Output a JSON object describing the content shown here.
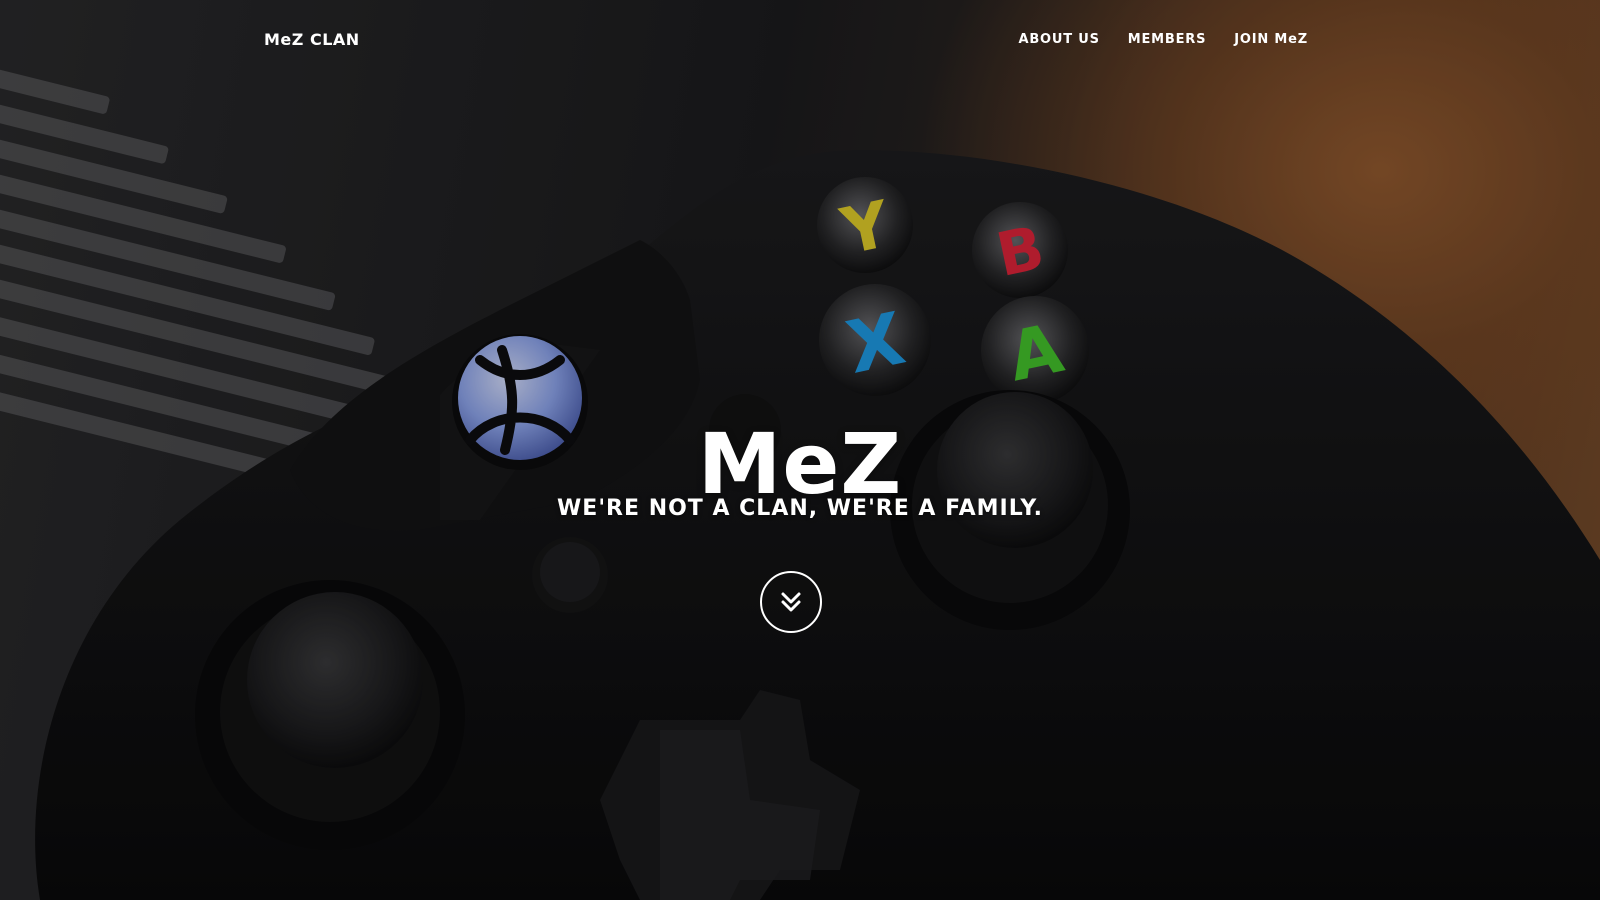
{
  "nav": {
    "brand": "MeZ CLAN",
    "links": [
      {
        "label": "ABOUT US"
      },
      {
        "label": "MEMBERS"
      },
      {
        "label": "JOIN MeZ"
      }
    ]
  },
  "hero": {
    "title": "MeZ",
    "tagline": "WE'RE NOT A CLAN, WE'RE A FAMILY.",
    "scroll_icon": "double-chevron-down-icon",
    "background_image": "xbox-controller-photo"
  },
  "colors": {
    "text": "#ffffff",
    "button_y": "#e3cf2a",
    "button_b": "#e0243a",
    "button_x": "#1e9be6",
    "button_a": "#44c52c",
    "xbox_logo": "#8fa6ee"
  }
}
